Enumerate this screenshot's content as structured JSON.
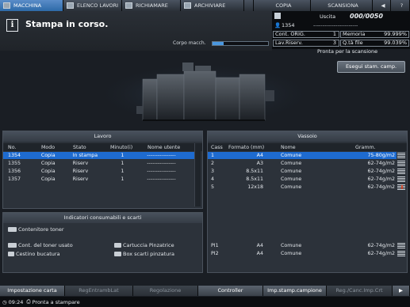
{
  "tabs": [
    {
      "label": "MACCHINA",
      "icon": "machine-icon"
    },
    {
      "label": "ELENCO LAVORI",
      "icon": "job-list-icon"
    },
    {
      "label": "RICHIAMARE",
      "icon": "recall-icon"
    },
    {
      "label": "ARCHIVIARE",
      "icon": "store-icon"
    },
    {
      "label": "COPIA",
      "icon": "copy-icon"
    },
    {
      "label": "SCANSIONA",
      "icon": "scan-icon"
    }
  ],
  "message": {
    "text": "Stampa in corso.",
    "corpo_label": "Corpo macch.",
    "corpo_progress": 0.2
  },
  "counter": {
    "uscita_label": "Uscita",
    "uscita_value": "000/0050",
    "user": "1354",
    "user_dashes": "------------------------",
    "cont_orig_label": "Cont. ORIG.",
    "cont_orig_value": "1",
    "memoria_label": "Memoria",
    "memoria_value": "99.999%",
    "lav_riserv_label": "Lav.Riserv.",
    "lav_riserv_value": "3",
    "qta_file_label": "Q.tà file",
    "qta_file_value": "99.039%"
  },
  "ready_text": "Pronta per la scansione",
  "esegui_label": "Esegui stam. camp.",
  "lavoro": {
    "title": "Lavoro",
    "headers": [
      "No.",
      "Modo",
      "Stato",
      "Minuto(i)",
      "Nome utente"
    ],
    "rows": [
      [
        "1354",
        "Copia",
        "In stampa",
        "1",
        "----------------"
      ],
      [
        "1355",
        "Copia",
        "Riserv",
        "1",
        "----------------"
      ],
      [
        "1356",
        "Copia",
        "Riserv",
        "1",
        "----------------"
      ],
      [
        "1357",
        "Copia",
        "Riserv",
        "1",
        "----------------"
      ]
    ]
  },
  "vassoio": {
    "title": "Vassoio",
    "headers": [
      "Cass",
      "Formato (mm)",
      "Nome",
      "Gramm."
    ],
    "rows": [
      [
        "1",
        "A4",
        "Comune",
        "75-80g/m2"
      ],
      [
        "2",
        "A3",
        "Comune",
        "62-74g/m2"
      ],
      [
        "3",
        "8.5x11",
        "Comune",
        "62-74g/m2"
      ],
      [
        "4",
        "8.5x11",
        "Comune",
        "62-74g/m2"
      ],
      [
        "5",
        "12x18",
        "Comune",
        "62-74g/m2"
      ]
    ],
    "pi_rows": [
      [
        "PI1",
        "A4",
        "Comune",
        "62-74g/m2"
      ],
      [
        "PI2",
        "A4",
        "Comune",
        "62-74g/m2"
      ]
    ]
  },
  "consumabili": {
    "title": "Indicatori consumabili e scarti",
    "toner": "Contenitore toner",
    "toner_usato": "Cont. del toner usato",
    "cucitrice": "Cartuccia Pinzatrice",
    "cestino": "Cestino bucatura",
    "box_scarti": "Box scarti pinzatura"
  },
  "bottom_buttons": [
    {
      "label": "Impostazione carta",
      "dim": false
    },
    {
      "label": "RegEntrambLat",
      "dim": true
    },
    {
      "label": "Regolazione",
      "dim": true
    },
    {
      "label": "Controller",
      "dim": false
    },
    {
      "label": "Imp.stamp.campione",
      "dim": false
    },
    {
      "label": "Reg./Canc.Imp.Crt",
      "dim": true
    }
  ],
  "status": {
    "time": "09:24",
    "text": "Pronta a stampare"
  },
  "colors": {
    "accent": "#1e6bd0",
    "active_tab": "#2d6aa8",
    "warn": "#e0401e"
  }
}
